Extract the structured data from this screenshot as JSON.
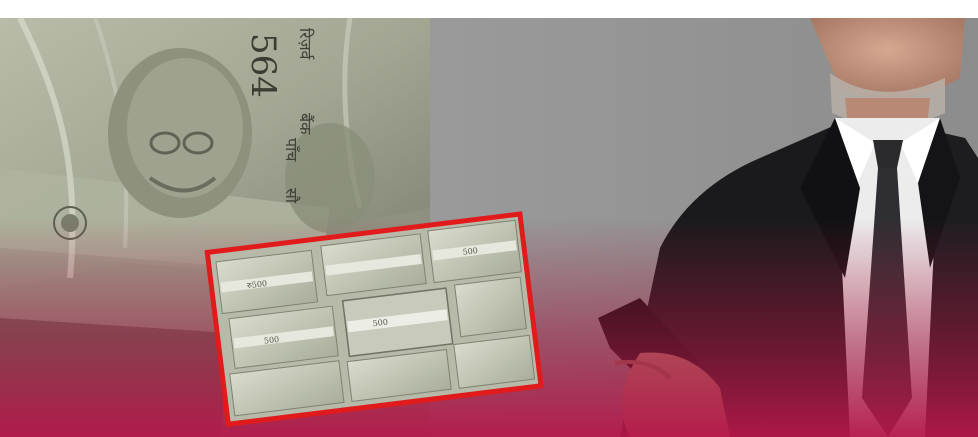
{
  "image": {
    "banknote_serial_text": "564",
    "banknote_script_lines": [
      "रिज़र्व",
      "बैंक",
      "पाँच",
      "सौ"
    ],
    "stack_band_text": [
      "रु500",
      "500",
      "500",
      "500"
    ],
    "colors": {
      "background_left": "#8f9180",
      "background_right": "#8a8a8a",
      "bottom_gradient": "#a0183f",
      "inset_border": "#e11b1b",
      "suit": "#1a1a1c",
      "tie": "#2b2b2e",
      "shirt": "#eeeeee",
      "skin": "#c99a84"
    }
  }
}
